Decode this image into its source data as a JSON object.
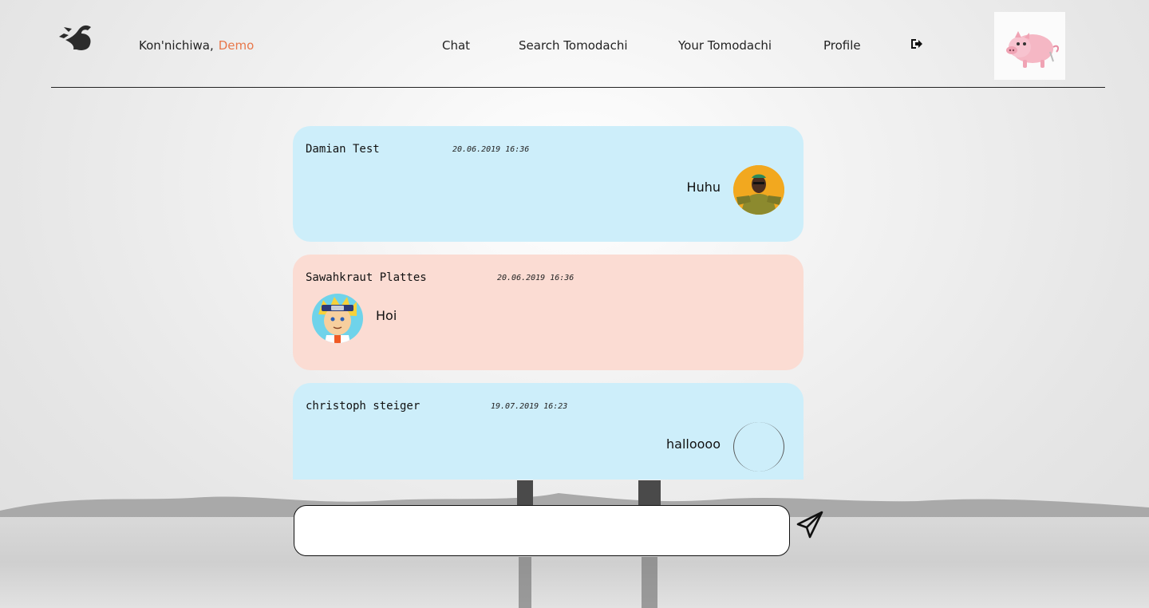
{
  "header": {
    "greeting": "Kon'nichiwa,",
    "user_name": "Demo",
    "nav": {
      "chat": "Chat",
      "search": "Search Tomodachi",
      "your": "Your Tomodachi",
      "profile": "Profile"
    },
    "logout_icon": "sign-out-icon",
    "logo_icon": "dragon-logo",
    "profile_image": "pig-avatar"
  },
  "messages": [
    {
      "author": "Damian Test",
      "time": "20.06.2019 16:36",
      "text": "Huhu",
      "color": "#cdeefa",
      "side": "right"
    },
    {
      "author": "Sawahkraut Plattes",
      "time": "20.06.2019 16:36",
      "text": "Hoi",
      "color": "#fbdcd3",
      "side": "left"
    },
    {
      "author": "christoph steiger",
      "time": "19.07.2019 16:23",
      "text": "halloooo",
      "color": "#cdeefa",
      "side": "right"
    }
  ],
  "composer": {
    "value": "",
    "placeholder": "",
    "send_icon": "paper-plane-icon"
  },
  "colors": {
    "accent": "#e8774a",
    "bubble_blue": "#cdeefa",
    "bubble_pink": "#fbdcd3"
  }
}
